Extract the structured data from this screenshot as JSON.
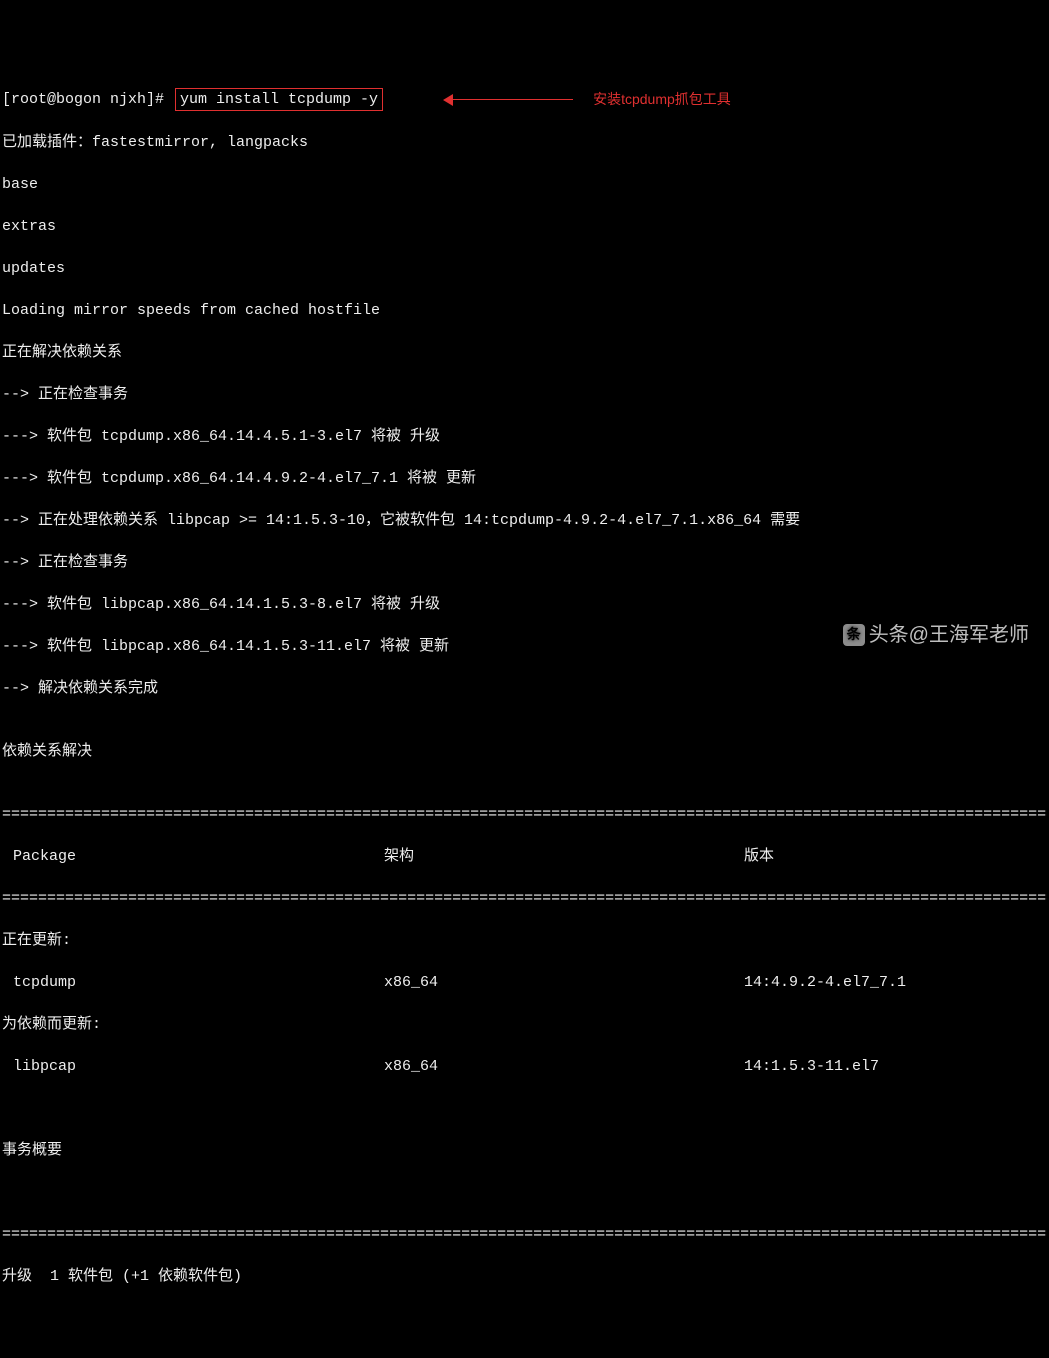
{
  "prompt": {
    "user_host": "[root@bogon njxh]# ",
    "command": "yum install tcpdump -y"
  },
  "annotation": "安装tcpdump抓包工具",
  "lines": [
    "已加载插件：fastestmirror, langpacks",
    "base",
    "extras",
    "updates",
    "Loading mirror speeds from cached hostfile",
    "正在解决依赖关系",
    "--> 正在检查事务",
    "---> 软件包 tcpdump.x86_64.14.4.5.1-3.el7 将被 升级",
    "---> 软件包 tcpdump.x86_64.14.4.9.2-4.el7_7.1 将被 更新",
    "--> 正在处理依赖关系 libpcap >= 14:1.5.3-10，它被软件包 14:tcpdump-4.9.2-4.el7_7.1.x86_64 需要",
    "--> 正在检查事务",
    "---> 软件包 libpcap.x86_64.14.1.5.3-8.el7 将被 升级",
    "---> 软件包 libpcap.x86_64.14.1.5.3-11.el7 将被 更新",
    "--> 解决依赖关系完成",
    "",
    "依赖关系解决",
    ""
  ],
  "table": {
    "header": {
      "pkg": " Package",
      "arch": "架构",
      "ver": "版本"
    },
    "updating_label": "正在更新:",
    "dep_updating_label": "为依赖而更新:",
    "rows": [
      {
        "pkg": " tcpdump",
        "arch": "x86_64",
        "ver": "14:4.9.2-4.el7_7.1"
      },
      {
        "pkg": " libpcap",
        "arch": "x86_64",
        "ver": "14:1.5.3-11.el7"
      }
    ]
  },
  "summary": {
    "title": "事务概要",
    "line": "升级  1 软件包 (+1 依赖软件包)"
  },
  "divider": "=========================================================================================================================================",
  "watermark": "头条@王海军老师"
}
